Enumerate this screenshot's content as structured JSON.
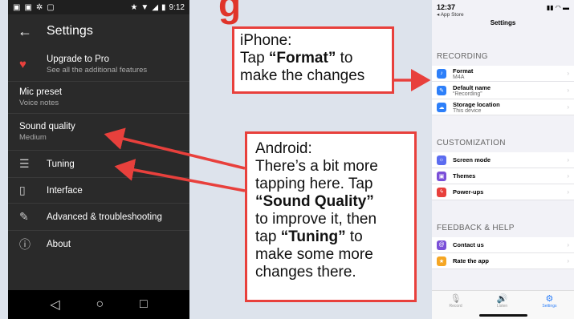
{
  "slide": {
    "title_fragment": "g"
  },
  "android": {
    "status_bar": {
      "time": "9:12"
    },
    "toolbar": {
      "title": "Settings"
    },
    "items": [
      {
        "title": "Upgrade to Pro",
        "subtitle": "See all the additional features",
        "icon": "heart-icon"
      },
      {
        "title": "Mic preset",
        "subtitle": "Voice notes"
      },
      {
        "title": "Sound quality",
        "subtitle": "Medium"
      },
      {
        "title": "Tuning",
        "icon": "tuning-sliders-icon"
      },
      {
        "title": "Interface",
        "icon": "interface-phone-icon"
      },
      {
        "title": "Advanced & troubleshooting",
        "icon": "wrench-icon"
      },
      {
        "title": "About",
        "icon": "info-icon"
      }
    ]
  },
  "callouts": {
    "iphone": {
      "line1": "iPhone:",
      "line2_pre": "Tap ",
      "line2_bold": "“Format”",
      "line2_post": " to",
      "line3": "make the changes"
    },
    "android": {
      "line1": "Android:",
      "line2": "There’s a bit more",
      "line3": "tapping here. Tap",
      "line4_bold": "“Sound Quality”",
      "line5": "to improve it, then",
      "line6_pre": "tap ",
      "line6_bold": "“Tuning”",
      "line6_post": " to",
      "line7": "make some more",
      "line8": "changes there."
    }
  },
  "iphone": {
    "status_bar": {
      "time": "12:37"
    },
    "back_label": "◂ App Store",
    "title": "Settings",
    "sections": [
      {
        "header": "RECORDING",
        "rows": [
          {
            "title": "Format",
            "subtitle": "M4A",
            "color": "#2d7ff9"
          },
          {
            "title": "Default name",
            "subtitle": "“Recording”",
            "color": "#2d7ff9"
          },
          {
            "title": "Storage location",
            "subtitle": "This device",
            "color": "#2d7ff9"
          }
        ]
      },
      {
        "header": "CUSTOMIZATION",
        "rows": [
          {
            "title": "Screen mode",
            "color": "#5b6cf0"
          },
          {
            "title": "Themes",
            "color": "#7a4fd8"
          },
          {
            "title": "Power-ups",
            "color": "#e8403c"
          }
        ]
      },
      {
        "header": "FEEDBACK & HELP",
        "rows": [
          {
            "title": "Contact us",
            "color": "#7a4fd8"
          },
          {
            "title": "Rate the app",
            "color": "#f5a623"
          }
        ]
      }
    ],
    "tabs": [
      {
        "label": "Record",
        "icon": "mic-icon"
      },
      {
        "label": "Listen",
        "icon": "speaker-icon"
      },
      {
        "label": "Settings",
        "icon": "gear-icon",
        "active": true
      }
    ]
  },
  "colors": {
    "accent_red": "#e8403c",
    "ios_blue": "#2d7ff9"
  }
}
